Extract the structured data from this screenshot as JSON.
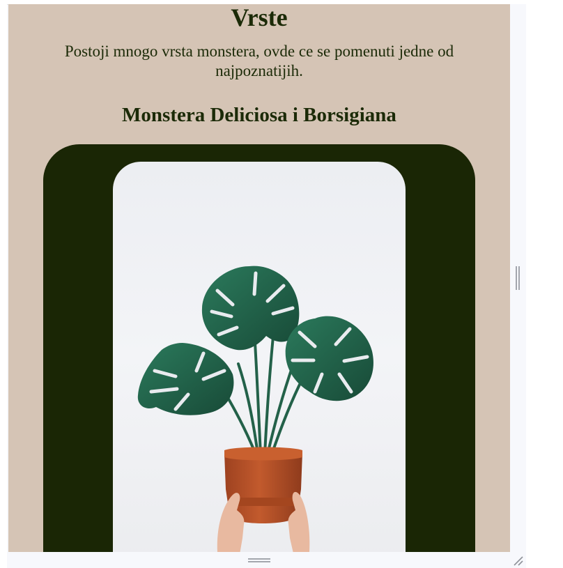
{
  "page": {
    "title": "Vrste",
    "intro": "Postoji mnogo vrsta monstera, ovde ce se pomenuti jedne od najpoznatijih.",
    "subheading": "Monstera Deliciosa i Borsigiana"
  },
  "image": {
    "subject": "monstera-plant-in-terracotta-pot-held-by-hands"
  },
  "colors": {
    "background": "#d5c4b5",
    "text": "#1b2a07",
    "arch": "#1a2605",
    "leaf": "#1f5e47",
    "pot": "#b9532a"
  },
  "icons": {
    "vertical_scroll_handle": "grip-vertical-icon",
    "horizontal_scroll_handle": "grip-horizontal-icon",
    "resize": "resize-grip-icon"
  }
}
